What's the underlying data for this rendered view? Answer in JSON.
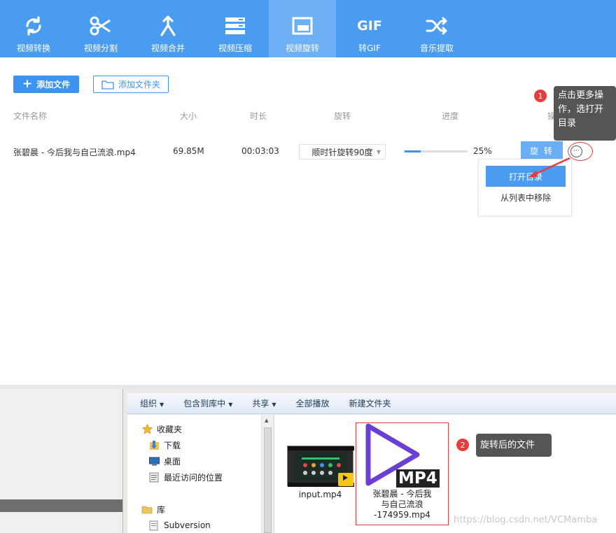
{
  "toolbar": {
    "items": [
      {
        "label": "视频转换",
        "icon": "convert-icon"
      },
      {
        "label": "视频分割",
        "icon": "scissors-icon"
      },
      {
        "label": "视频合并",
        "icon": "merge-icon"
      },
      {
        "label": "视频压缩",
        "icon": "compress-icon"
      },
      {
        "label": "视频旋转",
        "icon": "rotate-icon"
      },
      {
        "label": "转GIF",
        "icon": "gif-icon",
        "icon_text": "GIF"
      },
      {
        "label": "音乐提取",
        "icon": "shuffle-icon"
      }
    ],
    "active_index": 4
  },
  "actions": {
    "add_file": "添加文件",
    "add_folder": "添加文件夹"
  },
  "columns": {
    "name": "文件名称",
    "size": "大小",
    "duration": "时长",
    "rotate": "旋转",
    "progress": "进度",
    "operation": "操"
  },
  "row": {
    "filename": "张碧晨 - 今后我与自己流浪.mp4",
    "size": "69.85M",
    "duration": "00:03:03",
    "rotate_option": "顺时针旋转90度",
    "progress_text": "25%",
    "progress_value": 0.25,
    "rotate_button": "旋 转",
    "more_button": "···"
  },
  "menu": {
    "open_dir": "打开目录",
    "remove": "从列表中移除"
  },
  "callouts": {
    "c1_num": "1",
    "c1_text": "点击更多操作，选打开目录",
    "c2_num": "2",
    "c2_text": "旋转后的文件"
  },
  "explorer": {
    "toolbar": [
      "组织",
      "包含到库中",
      "共享",
      "全部播放",
      "新建文件夹"
    ],
    "nav": {
      "favorites": "收藏夹",
      "downloads": "下载",
      "desktop": "桌面",
      "recent": "最近访问的位置",
      "libraries": "库",
      "subversion": "Subversion"
    },
    "files": {
      "input": "input.mp4",
      "output_line1": "张碧晨 - 今后我",
      "output_line2": "与自己流浪",
      "output_line3": "-174959.mp4",
      "mp4_badge": "MP4"
    }
  },
  "watermark": "https://blog.csdn.net/VCMamba",
  "colors": {
    "primary": "#4a9cf0",
    "active_tab": "#6db0f5",
    "accent_red": "#e63c3c",
    "callout_bg": "#555555",
    "play_purple": "#6b3fd1"
  }
}
